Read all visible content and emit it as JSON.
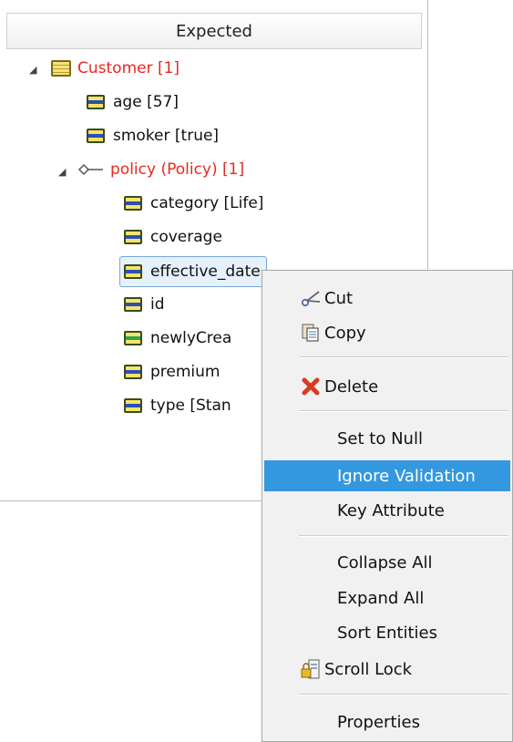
{
  "panel": {
    "header": "Expected",
    "tree": {
      "customer": "Customer [1]",
      "age": "age [57]",
      "smoker": "smoker [true]",
      "policy": "policy (Policy) [1]",
      "category": "category [Life]",
      "coverage": "coverage",
      "effective_date": "effective_date",
      "id": "id",
      "newlyCreated": "newlyCrea",
      "premium": "premium",
      "type": "type [Stan"
    }
  },
  "context_menu": {
    "cut": "Cut",
    "copy": "Copy",
    "delete": "Delete",
    "set_to_null": "Set to Null",
    "ignore_validation": "Ignore Validation",
    "key_attribute": "Key Attribute",
    "collapse_all": "Collapse All",
    "expand_all": "Expand All",
    "sort_entities": "Sort Entities",
    "scroll_lock": "Scroll Lock",
    "properties": "Properties",
    "highlight_color": "#3498e0"
  }
}
